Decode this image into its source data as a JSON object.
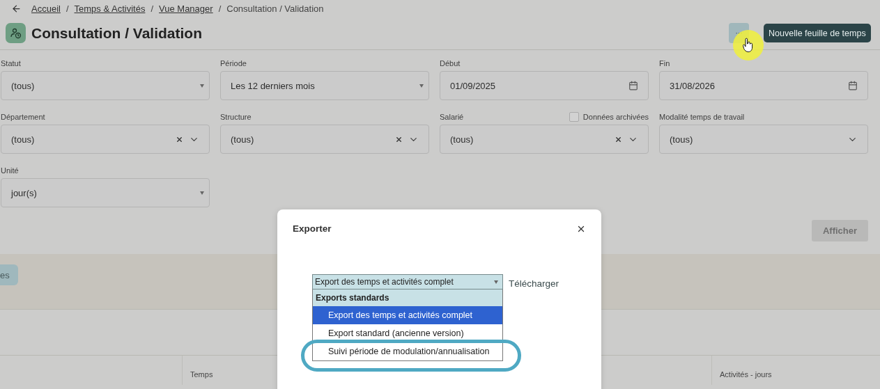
{
  "breadcrumb": [
    {
      "label": "Accueil",
      "kind": "link"
    },
    {
      "separator": "/",
      "label": "Temps & Activités",
      "kind": "link"
    },
    {
      "separator": "/",
      "label": "Vue Manager",
      "kind": "link"
    },
    {
      "separator": "/",
      "label": "Consultation / Validation",
      "kind": "current"
    }
  ],
  "page_title": "Consultation / Validation",
  "more_button": {
    "label": "···"
  },
  "tooltip": "Nouvelle feuille de temps",
  "filters": [
    {
      "label": "Statut",
      "value": "(tous)",
      "kind": "select"
    },
    {
      "label": "Période",
      "value": "Les 12 derniers mois",
      "kind": "select"
    },
    {
      "label": "Début",
      "value": "01/09/2025",
      "kind": "date"
    },
    {
      "label": "Fin",
      "value": "31/08/2026",
      "kind": "date"
    },
    {
      "label": "Département",
      "value": "(tous)",
      "kind": "clearable"
    },
    {
      "label": "Structure",
      "value": "(tous)",
      "kind": "clearable"
    },
    {
      "label": "Salarié",
      "value": "(tous)",
      "kind": "clearable",
      "checkbox": {
        "label": "Données archivées",
        "checked": false
      }
    },
    {
      "label": "Modalité temps de travail",
      "value": "(tous)",
      "kind": "chevron"
    },
    {
      "label": "Unité",
      "value": "jour(s)",
      "kind": "select"
    }
  ],
  "show_button": {
    "label": "Afficher",
    "disabled": true
  },
  "band_button": {
    "label": "es"
  },
  "table": {
    "columns": [
      {},
      {
        "label": "Temps"
      },
      {
        "label": "Activités - jours"
      }
    ]
  },
  "dialog": {
    "title": "Exporter",
    "select_value": "Export des temps et activités complet",
    "download": "Télécharger",
    "group": "Exports standards",
    "options": [
      {
        "label": "Export des temps et activités complet",
        "selected": true,
        "highlighted": false
      },
      {
        "label": "Export standard (ancienne version)",
        "selected": false,
        "highlighted": false
      },
      {
        "label": "Suivi période de modulation/annualisation",
        "selected": false,
        "highlighted": true
      }
    ]
  }
}
